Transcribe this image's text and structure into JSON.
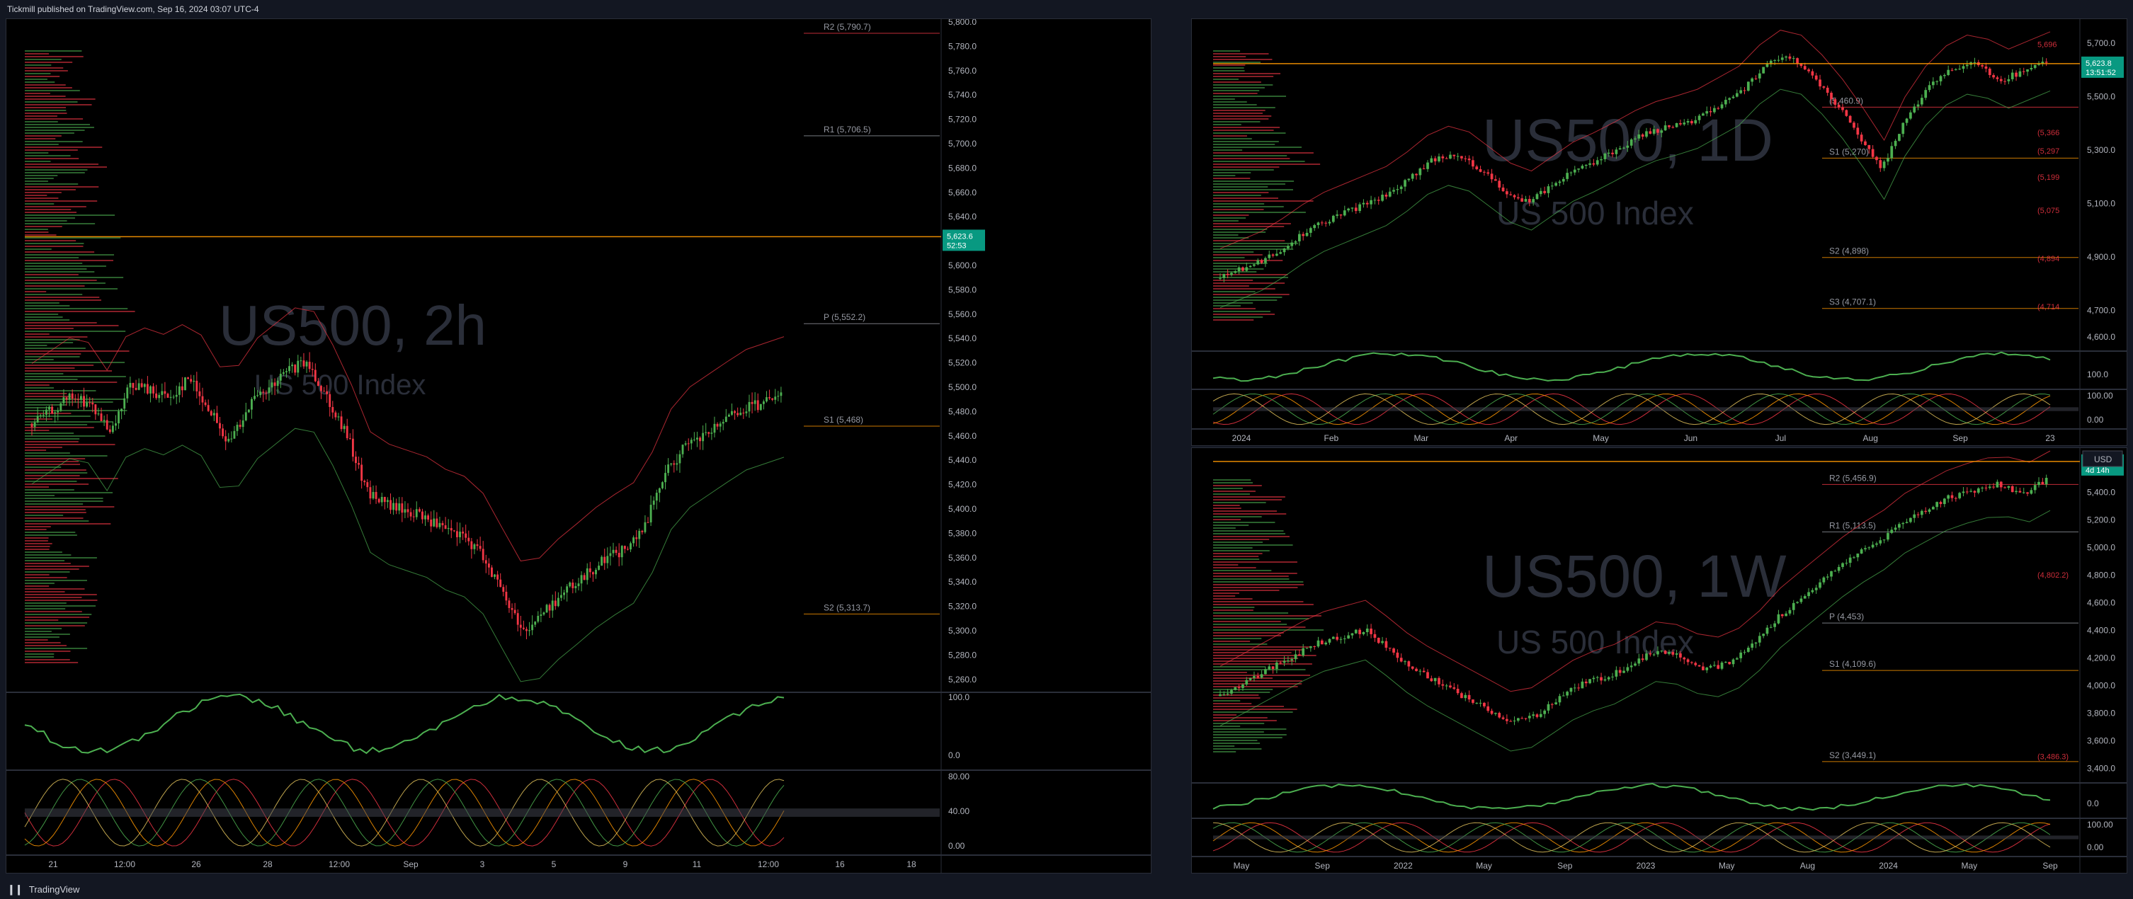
{
  "header": {
    "title": "Tickmill published on TradingView.com, Sep 16, 2024 03:07 UTC-4"
  },
  "footer": {
    "brand": "TradingView"
  },
  "colors": {
    "background": "#000000",
    "up": "#26a69a",
    "green": "#4caf50",
    "red": "#f23645",
    "orange": "#ff9800",
    "price_tag": "#089981"
  },
  "chart_data": [
    {
      "type": "candlestick",
      "watermark": "US500, 2h",
      "subtitle": "US 500 Index",
      "price_axis": [
        "5,800.0",
        "5,780.0",
        "5,760.0",
        "5,740.0",
        "5,720.0",
        "5,700.0",
        "5,680.0",
        "5,660.0",
        "5,640.0",
        "5,620.0",
        "5,600.0",
        "5,580.0",
        "5,560.0",
        "5,540.0",
        "5,520.0",
        "5,500.0",
        "5,480.0",
        "5,460.0",
        "5,440.0",
        "5,420.0",
        "5,400.0",
        "5,380.0",
        "5,360.0",
        "5,340.0",
        "5,320.0",
        "5,300.0",
        "5,280.0",
        "5,260.0"
      ],
      "ylim": [
        5250,
        5800
      ],
      "time_axis": [
        "21",
        "12:00",
        "26",
        "28",
        "12:00",
        "Sep",
        "3",
        "5",
        "9",
        "11",
        "12:00",
        "16",
        "18"
      ],
      "pivots": [
        {
          "label": "R2 (5,790.7)",
          "value": 5790.7
        },
        {
          "label": "R1 (5,706.5)",
          "value": 5706.5
        },
        {
          "label": "P (5,552.2)",
          "value": 5552.2
        },
        {
          "label": "S1 (5,468)",
          "value": 5468
        },
        {
          "label": "S2 (5,313.7)",
          "value": 5313.7
        }
      ],
      "last_price": "5,623.6",
      "countdown": "52:53",
      "rsi_axis": [
        "100.0",
        "0.0"
      ],
      "stoch_axis": [
        "80.00",
        "40.00",
        "0.00"
      ]
    },
    {
      "type": "candlestick",
      "watermark": "US500, 1D",
      "subtitle": "US 500 Index",
      "price_axis": [
        "5,700.0",
        "5,500.0",
        "5,300.0",
        "5,100.0",
        "4,900.0",
        "4,700.0",
        "4,600.0"
      ],
      "ylim": [
        4550,
        5780
      ],
      "time_axis": [
        "2024",
        "Feb",
        "Mar",
        "Apr",
        "May",
        "Jun",
        "Jul",
        "Aug",
        "Sep",
        "23"
      ],
      "pivots": [
        {
          "label": "(5,460.9)",
          "value": 5460.9
        },
        {
          "label": "S1 (5,270)",
          "value": 5270
        },
        {
          "label": "S2 (4,898)",
          "value": 4898
        },
        {
          "label": "S3 (4,707.1)",
          "value": 4707.1
        }
      ],
      "side_labels": [
        "5,696",
        "(5,366",
        "(5,297",
        "(5,199",
        "(5,075",
        "(4,894",
        "(4,714"
      ],
      "last_price": "5,623.8",
      "countdown": "13:51:52",
      "rsi_axis": [
        "100.0"
      ],
      "stoch_axis": [
        "100.00",
        "0.00"
      ]
    },
    {
      "type": "candlestick",
      "watermark": "US500, 1W",
      "subtitle": "US 500 Index",
      "price_axis": [
        "5,600.0",
        "5,400.0",
        "5,200.0",
        "5,000.0",
        "4,800.0",
        "4,600.0",
        "4,400.0",
        "4,200.0",
        "4,000.0",
        "3,800.0",
        "3,600.0",
        "3,400.0"
      ],
      "ylim": [
        3300,
        5700
      ],
      "time_axis": [
        "May",
        "Sep",
        "2022",
        "May",
        "Sep",
        "2023",
        "May",
        "Aug",
        "2024",
        "May",
        "Sep"
      ],
      "pivots": [
        {
          "label": "R2 (5,456.9)",
          "value": 5456.9
        },
        {
          "label": "R1 (5,113.5)",
          "value": 5113.5
        },
        {
          "label": "P (4,453)",
          "value": 4453
        },
        {
          "label": "S1 (4,109.6)",
          "value": 4109.6
        },
        {
          "label": "S2 (3,449.1)",
          "value": 3449.1
        }
      ],
      "side_labels": [
        "(4,802.2)",
        "(3,486.3)"
      ],
      "currency": "USD",
      "last_price": "5,623.8",
      "countdown": "4d 14h",
      "rsi_axis": [
        "0.0"
      ],
      "stoch_axis": [
        "100.00",
        "0.00"
      ]
    }
  ]
}
